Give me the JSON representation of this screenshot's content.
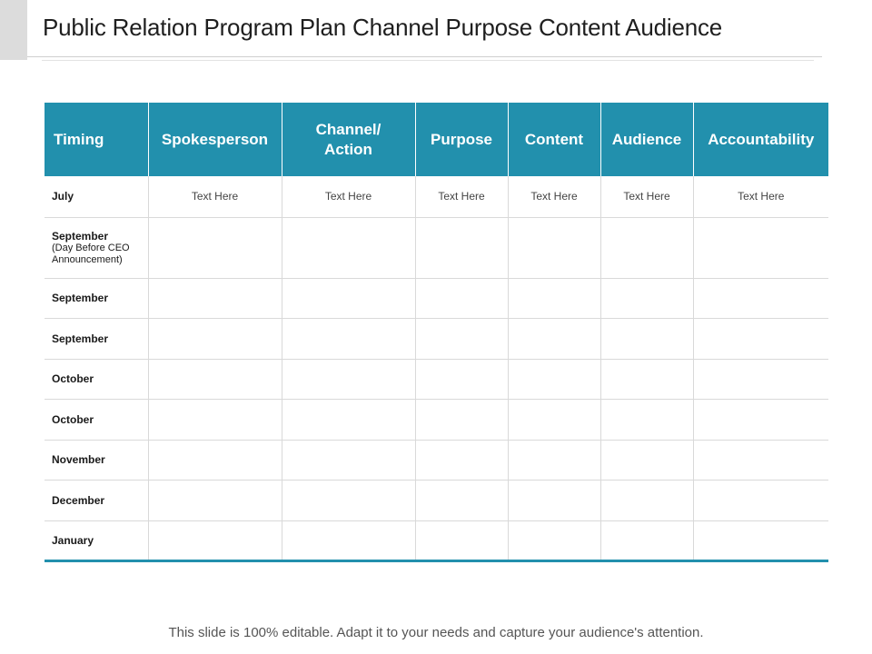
{
  "slide": {
    "title": "Public Relation Program Plan Channel Purpose Content Audience",
    "footer": "This slide is 100% editable. Adapt it to your needs and capture your audience's attention."
  },
  "table": {
    "headers": [
      "Timing",
      "Spokesperson",
      "Channel/ Action",
      "Purpose",
      "Content",
      "Audience",
      "Accountability"
    ],
    "rows": [
      {
        "timing": "July",
        "cells": [
          "Text Here",
          "Text Here",
          "Text Here",
          "Text Here",
          "Text Here",
          "Text Here"
        ]
      },
      {
        "timing": "September",
        "timing_note": "(Day Before CEO Announcement)",
        "cells": [
          "",
          "",
          "",
          "",
          "",
          ""
        ]
      },
      {
        "timing": "September",
        "cells": [
          "",
          "",
          "",
          "",
          "",
          ""
        ]
      },
      {
        "timing": "September",
        "cells": [
          "",
          "",
          "",
          "",
          "",
          ""
        ]
      },
      {
        "timing": "October",
        "cells": [
          "",
          "",
          "",
          "",
          "",
          ""
        ]
      },
      {
        "timing": "October",
        "cells": [
          "",
          "",
          "",
          "",
          "",
          ""
        ]
      },
      {
        "timing": "November",
        "cells": [
          "",
          "",
          "",
          "",
          "",
          ""
        ]
      },
      {
        "timing": "December",
        "cells": [
          "",
          "",
          "",
          "",
          "",
          ""
        ]
      },
      {
        "timing": "January",
        "cells": [
          "",
          "",
          "",
          "",
          "",
          ""
        ]
      }
    ]
  },
  "colors": {
    "header_bg": "#2290ad",
    "header_text": "#ffffff",
    "grid_line": "#d9d9d9"
  }
}
